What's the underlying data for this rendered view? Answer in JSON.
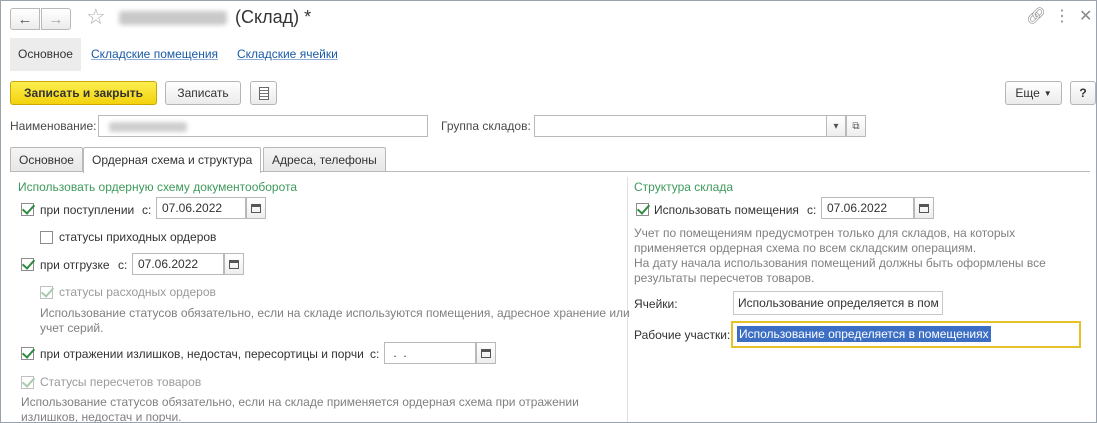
{
  "window": {
    "title": "(Склад) *",
    "icons": [
      "back-arrow-icon",
      "forward-arrow-icon",
      "star-icon",
      "link-icon",
      "more-icon",
      "close-icon"
    ]
  },
  "sections": {
    "main": "Основное",
    "rooms": "Складские помещения",
    "cells": "Складские ячейки"
  },
  "toolbar": {
    "save_close": "Записать и закрыть",
    "save": "Записать",
    "more": "Еще",
    "help": "?"
  },
  "form": {
    "name_label": "Наименование:",
    "group_label": "Группа складов:",
    "group_value": ""
  },
  "tabs": [
    "Основное",
    "Ордерная схема и структура",
    "Адреса, телефоны"
  ],
  "left": {
    "title": "Использовать ордерную схему документооборота",
    "receipt_label": "при поступлении",
    "receipt_from": "с:",
    "receipt_date": "07.06.2022",
    "receipt_statuses": "статусы приходных ордеров",
    "shipment_label": "при отгрузке",
    "shipment_from": "с:",
    "shipment_date": "07.06.2022",
    "shipment_statuses": "статусы расходных ордеров",
    "shipment_note_1": "Использование статусов обязательно, если на складе используются помещения, адресное хранение или",
    "shipment_note_2": "учет серий.",
    "surplus_label": "при отражении излишков, недостач, пересортицы и порчи",
    "surplus_from": "с:",
    "surplus_date": " .  .",
    "recount_statuses": "Статусы пересчетов товаров",
    "recount_note_1": "Использование статусов обязательно, если на складе применяется ордерная схема при отражении",
    "recount_note_2": "излишков, недостач и порчи."
  },
  "right": {
    "title": "Структура склада",
    "use_rooms_label": "Использовать помещения",
    "use_rooms_from": "с:",
    "use_rooms_date": "07.06.2022",
    "note_1": "Учет по помещениям предусмотрен только для складов, на которых",
    "note_2": "применяется ордерная схема по всем складским операциям.",
    "note_3": "На дату начала использования помещений должны быть оформлены все",
    "note_4": "результаты пересчетов товаров.",
    "cells_label": "Ячейки:",
    "cells_value": "Использование определяется в пом",
    "workarea_label": "Рабочие участки:",
    "workarea_value": "Использование определяется в помещениях"
  }
}
